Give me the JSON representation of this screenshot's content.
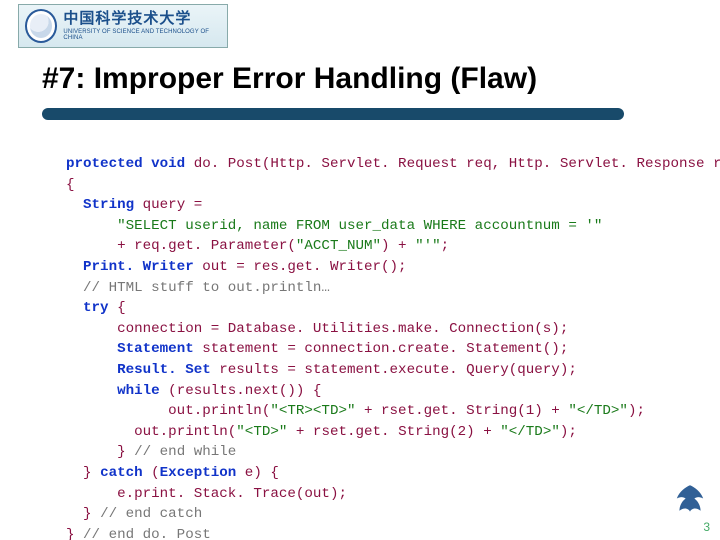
{
  "logo": {
    "cn": "中国科学技术大学",
    "en": "UNIVERSITY OF SCIENCE AND TECHNOLOGY OF CHINA"
  },
  "title": "#7: Improper Error Handling (Flaw)",
  "code": {
    "l1a": "protected",
    "l1b": "void",
    "l1c": "do. Post(Http. Servlet. Request req, Http. Servlet. Response res)",
    "l2": "{",
    "l3a": "String",
    "l3b": "query =",
    "l4": "\"SELECT userid, name FROM user_data WHERE accountnum = '\"",
    "l5a": "+ req.get. Parameter(",
    "l5b": "\"ACCT_NUM\"",
    "l5c": ") + ",
    "l5d": "\"'\"",
    "l5e": ";",
    "l6a": "Print. Writer",
    "l6b": "out = res.get. Writer();",
    "l7": "// HTML stuff to out.println…",
    "l8a": "try",
    "l8b": " {",
    "l9": "connection = Database. Utilities.make. Connection(s);",
    "l10a": "Statement",
    "l10b": "statement = connection.create. Statement();",
    "l11a": "Result. Set",
    "l11b": "results = statement.execute. Query(query);",
    "l12a": "while",
    "l12b": " (results.next()) {",
    "l13a": "out.println(",
    "l13b": "\"<TR><TD>\"",
    "l13c": " + rset.get. String(1) + ",
    "l13d": "\"</TD>\"",
    "l13e": ");",
    "l14a": "out.println(",
    "l14b": "\"<TD>\"",
    "l14c": " + rset.get. String(2) + ",
    "l14d": "\"</TD>\"",
    "l14e": ");",
    "l15a": "} ",
    "l15b": "// end while",
    "l16a": "} ",
    "l16b": "catch",
    "l16c": " (",
    "l16d": "Exception",
    "l16e": " e) {",
    "l17": "e.print. Stack. Trace(out);",
    "l18a": "} ",
    "l18b": "// end catch",
    "l19a": "} ",
    "l19b": "// end do. Post"
  },
  "page": "3"
}
